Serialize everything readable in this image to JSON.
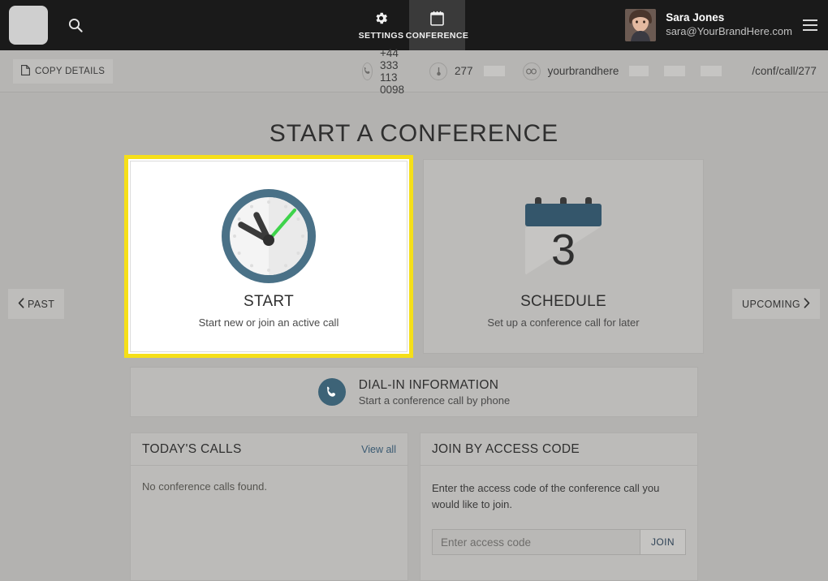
{
  "topbar": {
    "logo_icon": "brand-logo-placeholder",
    "search_icon": "search-icon",
    "tabs": [
      {
        "label": "SETTINGS",
        "icon": "gear-icon",
        "active": false
      },
      {
        "label": "CONFERENCE",
        "icon": "calendar-icon",
        "active": true
      }
    ],
    "user": {
      "name": "Sara Jones",
      "email": "sara@YourBrandHere.com",
      "avatar_icon": "user-avatar-photo"
    },
    "menu_icon": "hamburger-menu-icon"
  },
  "infobar": {
    "copy_details_label": "COPY DETAILS",
    "copy_icon": "copy-document-icon",
    "items": [
      {
        "icon": "phone-icon",
        "text": "+44 333 113 0098",
        "redacted": false
      },
      {
        "icon": "pin-code-icon",
        "text": "277",
        "redacted": true
      },
      {
        "icon": "link-icon",
        "text": "yourbrandhere",
        "redacted": true
      },
      {
        "icon": "",
        "text": "/conf/call/277",
        "redacted": true
      }
    ]
  },
  "main": {
    "page_title": "START A CONFERENCE",
    "nav_past": {
      "label": "PAST",
      "icon": "chevron-left-icon"
    },
    "nav_upcoming": {
      "label": "UPCOMING",
      "icon": "chevron-right-icon"
    },
    "cards": [
      {
        "icon": "clock-icon",
        "title": "START",
        "subtitle": "Start new or join an active call",
        "focused": true
      },
      {
        "icon": "calendar-day-icon",
        "calendar_day": "3",
        "title": "SCHEDULE",
        "subtitle": "Set up a conference call for later",
        "focused": false
      }
    ],
    "dialin": {
      "icon": "phone-handset-icon",
      "title": "DIAL-IN INFORMATION",
      "subtitle": "Start a conference call by phone"
    },
    "panels": [
      {
        "title": "TODAY'S CALLS",
        "action_label": "View all",
        "empty_message": "No conference calls found."
      },
      {
        "title": "JOIN BY ACCESS CODE",
        "description": "Enter the access code of the conference call you would like to join.",
        "input_placeholder": "Enter access code",
        "input_value": "",
        "join_label": "JOIN"
      }
    ]
  },
  "colors": {
    "topbar_bg": "#1a1a1a",
    "page_bg": "#b3b2b0",
    "focus_yellow": "#f5df19",
    "accent_teal": "#3d6377",
    "clock_green": "#3ed34b",
    "link_blue": "#3a5a72"
  }
}
